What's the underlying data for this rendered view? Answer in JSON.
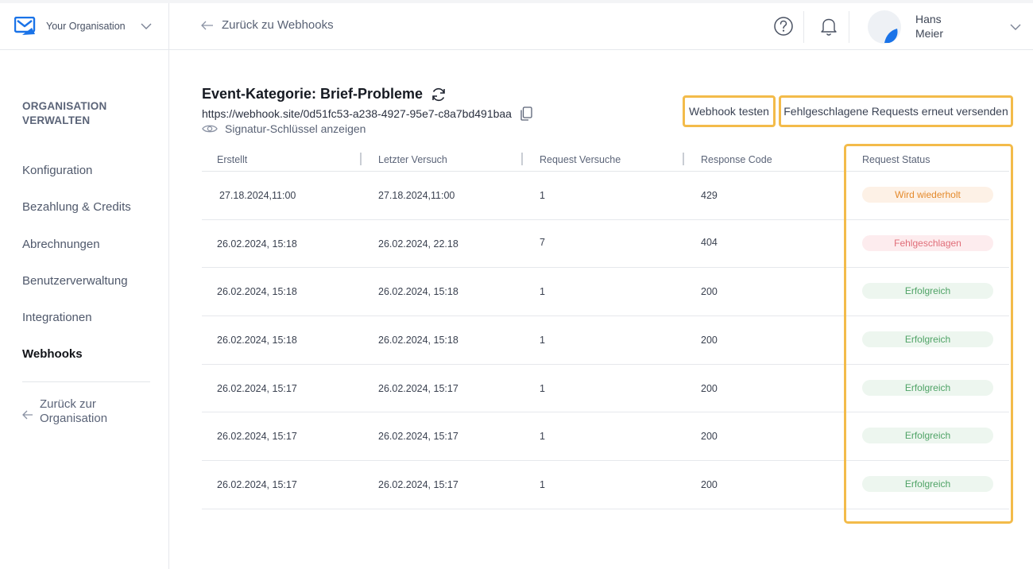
{
  "org": {
    "name": "Your Organisation"
  },
  "sidebar": {
    "heading": "ORGANISATION VERWALTEN",
    "items": [
      {
        "label": "Konfiguration"
      },
      {
        "label": "Bezahlung & Credits"
      },
      {
        "label": "Abrechnungen"
      },
      {
        "label": "Benutzerverwaltung"
      },
      {
        "label": "Integrationen"
      },
      {
        "label": "Webhooks",
        "active": true
      }
    ],
    "back_label": "Zurück zur Organisation"
  },
  "topbar": {
    "back_label": "Zurück zu Webhooks",
    "user_name": "Hans Meier"
  },
  "page": {
    "title": "Event-Kategorie: Brief-Probleme",
    "url": "https://webhook.site/0d51fc53-a238-4927-95e7-c8a7bd491baa",
    "signature_label": "Signatur-Schlüssel anzeigen",
    "test_button": "Webhook testen",
    "resend_button": "Fehlgeschlagene Requests erneut versenden"
  },
  "table": {
    "columns": [
      "Erstellt",
      "Letzter Versuch",
      "Request Versuche",
      "Response Code",
      "Request Status"
    ],
    "rows": [
      {
        "created": "27.18.2024,11:00",
        "last": "27.18.2024,11:00",
        "attempts": "1",
        "code": "429",
        "status": "Wird wiederholt",
        "kind": "retry"
      },
      {
        "created": "26.02.2024, 15:18",
        "last": "26.02.2024, 22.18",
        "attempts": "7",
        "code": "404",
        "status": "Fehlgeschlagen",
        "kind": "fail"
      },
      {
        "created": "26.02.2024, 15:18",
        "last": "26.02.2024, 15:18",
        "attempts": "1",
        "code": "200",
        "status": "Erfolgreich",
        "kind": "ok"
      },
      {
        "created": "26.02.2024, 15:18",
        "last": "26.02.2024, 15:18",
        "attempts": "1",
        "code": "200",
        "status": "Erfolgreich",
        "kind": "ok"
      },
      {
        "created": "26.02.2024, 15:17",
        "last": "26.02.2024, 15:17",
        "attempts": "1",
        "code": "200",
        "status": "Erfolgreich",
        "kind": "ok"
      },
      {
        "created": "26.02.2024, 15:17",
        "last": "26.02.2024, 15:17",
        "attempts": "1",
        "code": "200",
        "status": "Erfolgreich",
        "kind": "ok"
      },
      {
        "created": "26.02.2024, 15:17",
        "last": "26.02.2024, 15:17",
        "attempts": "1",
        "code": "200",
        "status": "Erfolgreich",
        "kind": "ok"
      }
    ]
  },
  "colors": {
    "accent": "#1a73e8",
    "highlight": "#f3bb4a",
    "status_retry": "#e48a2c",
    "status_fail": "#e06d78",
    "status_ok": "#4fa366"
  },
  "icons": [
    "mail-logo-icon",
    "chevron-down-icon",
    "arrow-left-icon",
    "help-icon",
    "bell-icon",
    "refresh-icon",
    "copy-icon",
    "eye-icon"
  ]
}
